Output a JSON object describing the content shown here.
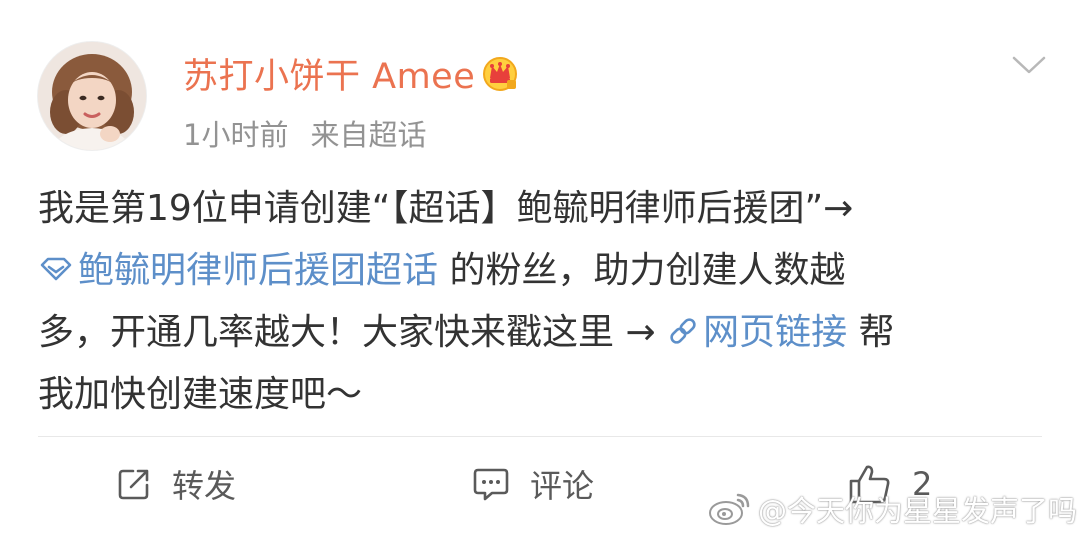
{
  "post": {
    "author": {
      "name": "苏打小饼干 Amee",
      "avatar_icon": "user-avatar",
      "badge_icon": "crown-badge-icon"
    },
    "meta": {
      "time": "1小时前",
      "source": "来自超话"
    },
    "body": {
      "line1": "我是第19位申请创建“【超话】鲍毓明律师后援团”→",
      "topic_link": "鲍毓明律师后援团超话",
      "line2_rest": " 的粉丝，助力创建人数越",
      "line3_prefix": "多，开通几率越大！大家快来戳这里 → ",
      "web_link": "网页链接",
      "line3_suffix": " 帮",
      "line4": "我加快创建速度吧～"
    },
    "actions": {
      "repost_label": "转发",
      "comment_label": "评论",
      "like_count": "2"
    }
  },
  "watermark": {
    "text": "@今天你为星星发声了吗"
  },
  "colors": {
    "username": "#eb7350",
    "link": "#5d8fc9",
    "meta": "#939393",
    "body": "#333333",
    "divider": "#e8e8e8"
  }
}
